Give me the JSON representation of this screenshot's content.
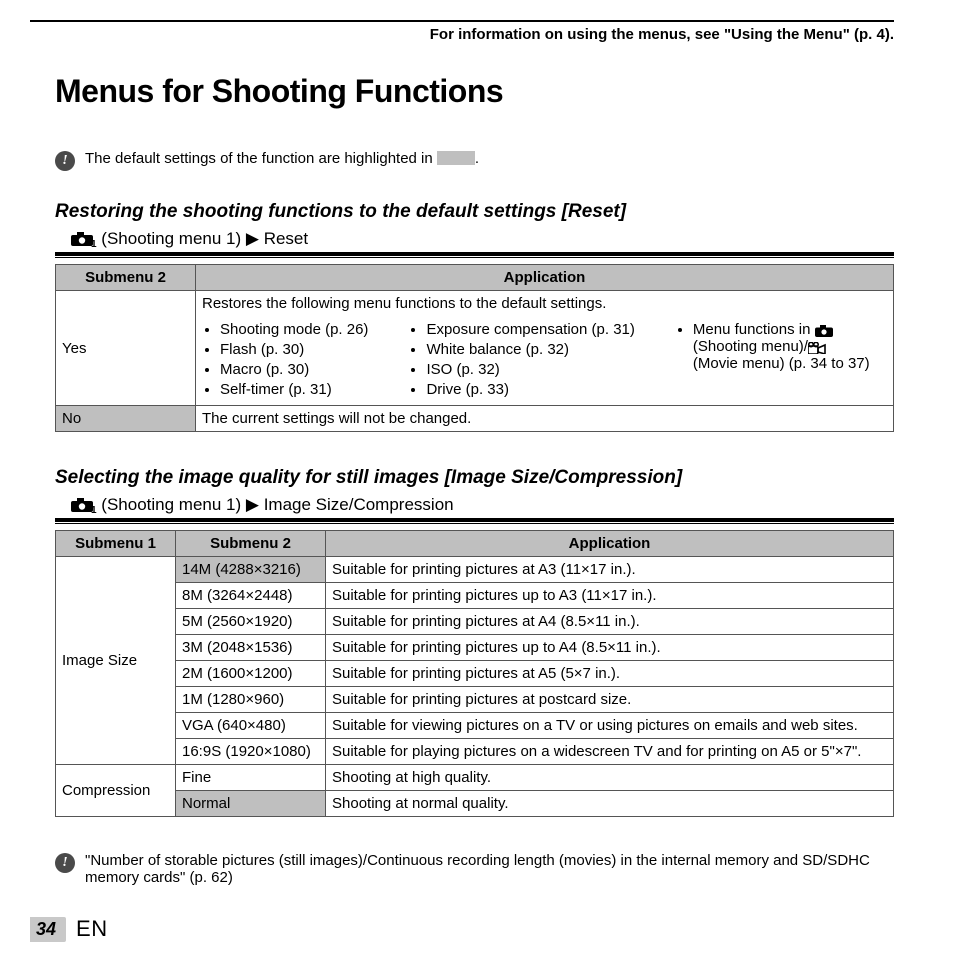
{
  "header": {
    "crossref": "For information on using the menus, see \"Using the Menu\" (p. 4)."
  },
  "title": "Menus for Shooting Functions",
  "intro_note": {
    "before": "The default settings of the function are highlighted in ",
    "after": "."
  },
  "reset": {
    "heading": "Restoring the shooting functions to the default settings [Reset]",
    "path_prefix": " (Shooting menu 1) ",
    "path_target": "Reset",
    "headers": {
      "sub2": "Submenu 2",
      "app": "Application"
    },
    "yes_label": "Yes",
    "yes_intro": "Restores the following menu functions to the default settings.",
    "col1": [
      "Shooting mode (p. 26)",
      "Flash (p. 30)",
      "Macro (p. 30)",
      "Self-timer (p. 31)"
    ],
    "col2": [
      "Exposure compensation (p. 31)",
      "White balance (p. 32)",
      "ISO (p. 32)",
      "Drive (p. 33)"
    ],
    "col3_line1a": "Menu functions in ",
    "col3_line2": "(Shooting menu)/",
    "col3_line3": "(Movie menu) (p. 34 to 37)",
    "no_label": "No",
    "no_text": "The current settings will not be changed."
  },
  "image_quality": {
    "heading": "Selecting the image quality for still images [Image Size/Compression]",
    "path_prefix": " (Shooting menu 1) ",
    "path_target": "Image Size/Compression",
    "headers": {
      "sub1": "Submenu 1",
      "sub2": "Submenu 2",
      "app": "Application"
    },
    "size_label": "Image Size",
    "comp_label": "Compression",
    "sizes": [
      {
        "v": "14M (4288×3216)",
        "a": "Suitable for printing pictures at A3 (11×17 in.).",
        "hl": true
      },
      {
        "v": "8M (3264×2448)",
        "a": "Suitable for printing pictures up to A3 (11×17 in.)."
      },
      {
        "v": "5M (2560×1920)",
        "a": "Suitable for printing pictures at A4 (8.5×11 in.)."
      },
      {
        "v": "3M (2048×1536)",
        "a": "Suitable for printing pictures up to A4 (8.5×11 in.)."
      },
      {
        "v": "2M (1600×1200)",
        "a": "Suitable for printing pictures at A5 (5×7 in.)."
      },
      {
        "v": "1M (1280×960)",
        "a": "Suitable for printing pictures at postcard size."
      },
      {
        "v": "VGA (640×480)",
        "a": "Suitable for viewing pictures on a TV or using pictures on emails and web sites."
      },
      {
        "v": "16:9S (1920×1080)",
        "a": "Suitable for playing pictures on a widescreen TV and for printing on A5 or 5\"×7\"."
      }
    ],
    "comps": [
      {
        "v": "Fine",
        "a": "Shooting at high quality."
      },
      {
        "v": "Normal",
        "a": "Shooting at normal quality.",
        "hl": true
      }
    ]
  },
  "foot_note": "\"Number of storable pictures (still images)/Continuous recording length (movies) in the internal memory and SD/SDHC memory cards\" (p. 62)",
  "footer": {
    "page": "34",
    "lang": "EN"
  }
}
